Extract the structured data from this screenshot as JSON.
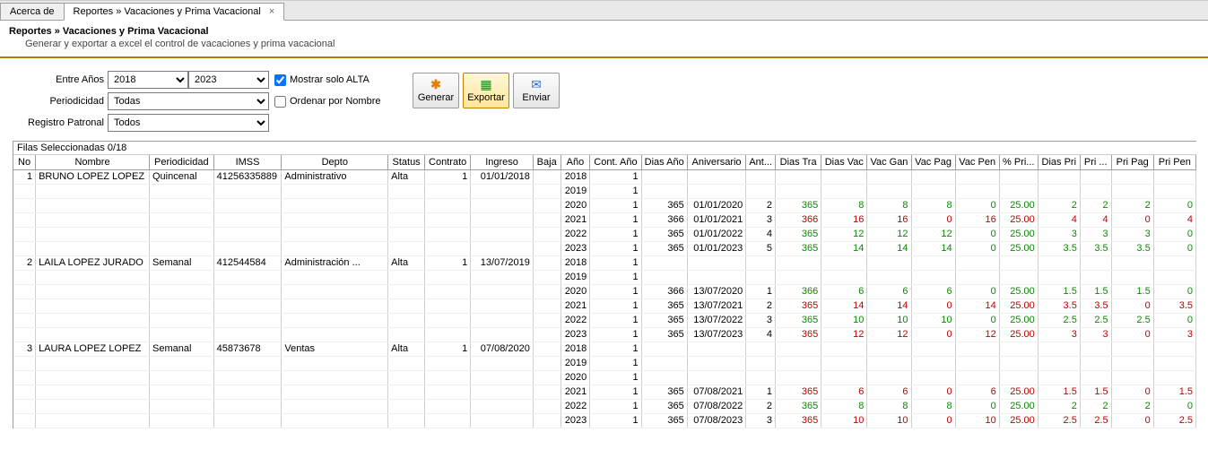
{
  "tabs": [
    {
      "label": "Acerca de",
      "active": false,
      "closable": false
    },
    {
      "label": "Reportes » Vacaciones y Prima Vacacional",
      "active": true,
      "closable": true
    }
  ],
  "header": {
    "title": "Reportes » Vacaciones y Prima Vacacional",
    "subtitle": "Generar y exportar a excel el control de vacaciones y prima vacacional"
  },
  "controls": {
    "entre_anos_label": "Entre Años",
    "year_from": "2018",
    "year_to": "2023",
    "mostrar_alta_label": "Mostrar solo ALTA",
    "mostrar_alta_checked": true,
    "periodicidad_label": "Periodicidad",
    "periodicidad_value": "Todas",
    "ordenar_label": "Ordenar por Nombre",
    "ordenar_checked": false,
    "registro_label": "Registro Patronal",
    "registro_value": "Todos",
    "btn_generar": "Generar",
    "btn_exportar": "Exportar",
    "btn_enviar": "Enviar"
  },
  "grid": {
    "selection": "Filas Seleccionadas  0/18",
    "columns": [
      "No",
      "Nombre",
      "Periodicidad",
      "IMSS",
      "Depto",
      "Status",
      "Contrato",
      "Ingreso",
      "Baja",
      "Año",
      "Cont. Año",
      "Dias Año",
      "Aniversario",
      "Ant...",
      "Dias Tra",
      "Dias Vac",
      "Vac Gan",
      "Vac Pag",
      "Vac Pen",
      "% Pri...",
      "Dias Pri",
      "Pri ...",
      "Pri Pag",
      "Pri Pen"
    ],
    "employees": [
      {
        "no": "1",
        "nombre": "BRUNO LOPEZ LOPEZ",
        "periodicidad": "Quincenal",
        "imss": "41256335889",
        "depto": "Administrativo",
        "status": "Alta",
        "contrato": "1",
        "ingreso": "01/01/2018",
        "baja": "",
        "years": [
          {
            "ano": "2018",
            "cont": "1",
            "diasano": "",
            "aniv": "",
            "ant": "",
            "diastra": "",
            "diasvac": "",
            "vacgan": "",
            "vacpag": "",
            "vacpen": "",
            "pct": "",
            "diaspri": "",
            "pri": "",
            "pripag": "",
            "pripen": ""
          },
          {
            "ano": "2019",
            "cont": "1",
            "diasano": "",
            "aniv": "",
            "ant": "",
            "diastra": "",
            "diasvac": "",
            "vacgan": "",
            "vacpag": "",
            "vacpen": "",
            "pct": "",
            "diaspri": "",
            "pri": "",
            "pripag": "",
            "pripen": ""
          },
          {
            "ano": "2020",
            "cont": "1",
            "diasano": "365",
            "aniv": "01/01/2020",
            "ant": "2",
            "diastra": {
              "v": "365",
              "c": "green"
            },
            "diasvac": {
              "v": "8",
              "c": "green"
            },
            "vacgan": {
              "v": "8",
              "c": "green"
            },
            "vacpag": {
              "v": "8",
              "c": "green"
            },
            "vacpen": {
              "v": "0",
              "c": "green"
            },
            "pct": {
              "v": "25.00",
              "c": "green"
            },
            "diaspri": {
              "v": "2",
              "c": "green"
            },
            "pri": {
              "v": "2",
              "c": "green"
            },
            "pripag": {
              "v": "2",
              "c": "green"
            },
            "pripen": {
              "v": "0",
              "c": "green"
            }
          },
          {
            "ano": "2021",
            "cont": "1",
            "diasano": "366",
            "aniv": "01/01/2021",
            "ant": "3",
            "diastra": {
              "v": "366",
              "c": "red"
            },
            "diasvac": {
              "v": "16",
              "c": "red"
            },
            "vacgan": {
              "v": "16",
              "c": "red"
            },
            "vacpag": {
              "v": "0",
              "c": "red"
            },
            "vacpen": {
              "v": "16",
              "c": "red"
            },
            "pct": {
              "v": "25.00",
              "c": "red"
            },
            "diaspri": {
              "v": "4",
              "c": "red"
            },
            "pri": {
              "v": "4",
              "c": "red"
            },
            "pripag": {
              "v": "0",
              "c": "red"
            },
            "pripen": {
              "v": "4",
              "c": "red"
            }
          },
          {
            "ano": "2022",
            "cont": "1",
            "diasano": "365",
            "aniv": "01/01/2022",
            "ant": "4",
            "diastra": {
              "v": "365",
              "c": "green"
            },
            "diasvac": {
              "v": "12",
              "c": "green"
            },
            "vacgan": {
              "v": "12",
              "c": "green"
            },
            "vacpag": {
              "v": "12",
              "c": "green"
            },
            "vacpen": {
              "v": "0",
              "c": "green"
            },
            "pct": {
              "v": "25.00",
              "c": "green"
            },
            "diaspri": {
              "v": "3",
              "c": "green"
            },
            "pri": {
              "v": "3",
              "c": "green"
            },
            "pripag": {
              "v": "3",
              "c": "green"
            },
            "pripen": {
              "v": "0",
              "c": "green"
            }
          },
          {
            "ano": "2023",
            "cont": "1",
            "diasano": "365",
            "aniv": "01/01/2023",
            "ant": "5",
            "diastra": {
              "v": "365",
              "c": "green"
            },
            "diasvac": {
              "v": "14",
              "c": "green"
            },
            "vacgan": {
              "v": "14",
              "c": "green"
            },
            "vacpag": {
              "v": "14",
              "c": "green"
            },
            "vacpen": {
              "v": "0",
              "c": "green"
            },
            "pct": {
              "v": "25.00",
              "c": "green"
            },
            "diaspri": {
              "v": "3.5",
              "c": "green"
            },
            "pri": {
              "v": "3.5",
              "c": "green"
            },
            "pripag": {
              "v": "3.5",
              "c": "green"
            },
            "pripen": {
              "v": "0",
              "c": "green"
            }
          }
        ]
      },
      {
        "no": "2",
        "nombre": "LAILA LOPEZ JURADO",
        "periodicidad": "Semanal",
        "imss": "412544584",
        "depto": "Administración ...",
        "status": "Alta",
        "contrato": "1",
        "ingreso": "13/07/2019",
        "baja": "",
        "years": [
          {
            "ano": "2018",
            "cont": "1",
            "diasano": "",
            "aniv": "",
            "ant": "",
            "diastra": "",
            "diasvac": "",
            "vacgan": "",
            "vacpag": "",
            "vacpen": "",
            "pct": "",
            "diaspri": "",
            "pri": "",
            "pripag": "",
            "pripen": ""
          },
          {
            "ano": "2019",
            "cont": "1",
            "diasano": "",
            "aniv": "",
            "ant": "",
            "diastra": "",
            "diasvac": "",
            "vacgan": "",
            "vacpag": "",
            "vacpen": "",
            "pct": "",
            "diaspri": "",
            "pri": "",
            "pripag": "",
            "pripen": ""
          },
          {
            "ano": "2020",
            "cont": "1",
            "diasano": "366",
            "aniv": "13/07/2020",
            "ant": "1",
            "diastra": {
              "v": "366",
              "c": "green"
            },
            "diasvac": {
              "v": "6",
              "c": "green"
            },
            "vacgan": {
              "v": "6",
              "c": "green"
            },
            "vacpag": {
              "v": "6",
              "c": "green"
            },
            "vacpen": {
              "v": "0",
              "c": "green"
            },
            "pct": {
              "v": "25.00",
              "c": "green"
            },
            "diaspri": {
              "v": "1.5",
              "c": "green"
            },
            "pri": {
              "v": "1.5",
              "c": "green"
            },
            "pripag": {
              "v": "1.5",
              "c": "green"
            },
            "pripen": {
              "v": "0",
              "c": "green"
            }
          },
          {
            "ano": "2021",
            "cont": "1",
            "diasano": "365",
            "aniv": "13/07/2021",
            "ant": "2",
            "diastra": {
              "v": "365",
              "c": "red"
            },
            "diasvac": {
              "v": "14",
              "c": "red"
            },
            "vacgan": {
              "v": "14",
              "c": "red"
            },
            "vacpag": {
              "v": "0",
              "c": "red"
            },
            "vacpen": {
              "v": "14",
              "c": "red"
            },
            "pct": {
              "v": "25.00",
              "c": "red"
            },
            "diaspri": {
              "v": "3.5",
              "c": "red"
            },
            "pri": {
              "v": "3.5",
              "c": "red"
            },
            "pripag": {
              "v": "0",
              "c": "red"
            },
            "pripen": {
              "v": "3.5",
              "c": "red"
            }
          },
          {
            "ano": "2022",
            "cont": "1",
            "diasano": "365",
            "aniv": "13/07/2022",
            "ant": "3",
            "diastra": {
              "v": "365",
              "c": "green"
            },
            "diasvac": {
              "v": "10",
              "c": "green"
            },
            "vacgan": {
              "v": "10",
              "c": "green"
            },
            "vacpag": {
              "v": "10",
              "c": "green"
            },
            "vacpen": {
              "v": "0",
              "c": "green"
            },
            "pct": {
              "v": "25.00",
              "c": "green"
            },
            "diaspri": {
              "v": "2.5",
              "c": "green"
            },
            "pri": {
              "v": "2.5",
              "c": "green"
            },
            "pripag": {
              "v": "2.5",
              "c": "green"
            },
            "pripen": {
              "v": "0",
              "c": "green"
            }
          },
          {
            "ano": "2023",
            "cont": "1",
            "diasano": "365",
            "aniv": "13/07/2023",
            "ant": "4",
            "diastra": {
              "v": "365",
              "c": "red"
            },
            "diasvac": {
              "v": "12",
              "c": "red"
            },
            "vacgan": {
              "v": "12",
              "c": "red"
            },
            "vacpag": {
              "v": "0",
              "c": "red"
            },
            "vacpen": {
              "v": "12",
              "c": "red"
            },
            "pct": {
              "v": "25.00",
              "c": "red"
            },
            "diaspri": {
              "v": "3",
              "c": "red"
            },
            "pri": {
              "v": "3",
              "c": "red"
            },
            "pripag": {
              "v": "0",
              "c": "red"
            },
            "pripen": {
              "v": "3",
              "c": "red"
            }
          }
        ]
      },
      {
        "no": "3",
        "nombre": "LAURA LOPEZ LOPEZ",
        "periodicidad": "Semanal",
        "imss": "45873678",
        "depto": "Ventas",
        "status": "Alta",
        "contrato": "1",
        "ingreso": "07/08/2020",
        "baja": "",
        "years": [
          {
            "ano": "2018",
            "cont": "1",
            "diasano": "",
            "aniv": "",
            "ant": "",
            "diastra": "",
            "diasvac": "",
            "vacgan": "",
            "vacpag": "",
            "vacpen": "",
            "pct": "",
            "diaspri": "",
            "pri": "",
            "pripag": "",
            "pripen": ""
          },
          {
            "ano": "2019",
            "cont": "1",
            "diasano": "",
            "aniv": "",
            "ant": "",
            "diastra": "",
            "diasvac": "",
            "vacgan": "",
            "vacpag": "",
            "vacpen": "",
            "pct": "",
            "diaspri": "",
            "pri": "",
            "pripag": "",
            "pripen": ""
          },
          {
            "ano": "2020",
            "cont": "1",
            "diasano": "",
            "aniv": "",
            "ant": "",
            "diastra": "",
            "diasvac": "",
            "vacgan": "",
            "vacpag": "",
            "vacpen": "",
            "pct": "",
            "diaspri": "",
            "pri": "",
            "pripag": "",
            "pripen": ""
          },
          {
            "ano": "2021",
            "cont": "1",
            "diasano": "365",
            "aniv": "07/08/2021",
            "ant": "1",
            "diastra": {
              "v": "365",
              "c": "red"
            },
            "diasvac": {
              "v": "6",
              "c": "red"
            },
            "vacgan": {
              "v": "6",
              "c": "red"
            },
            "vacpag": {
              "v": "0",
              "c": "red"
            },
            "vacpen": {
              "v": "6",
              "c": "red"
            },
            "pct": {
              "v": "25.00",
              "c": "red"
            },
            "diaspri": {
              "v": "1.5",
              "c": "red"
            },
            "pri": {
              "v": "1.5",
              "c": "red"
            },
            "pripag": {
              "v": "0",
              "c": "red"
            },
            "pripen": {
              "v": "1.5",
              "c": "red"
            }
          },
          {
            "ano": "2022",
            "cont": "1",
            "diasano": "365",
            "aniv": "07/08/2022",
            "ant": "2",
            "diastra": {
              "v": "365",
              "c": "green"
            },
            "diasvac": {
              "v": "8",
              "c": "green"
            },
            "vacgan": {
              "v": "8",
              "c": "green"
            },
            "vacpag": {
              "v": "8",
              "c": "green"
            },
            "vacpen": {
              "v": "0",
              "c": "green"
            },
            "pct": {
              "v": "25.00",
              "c": "green"
            },
            "diaspri": {
              "v": "2",
              "c": "green"
            },
            "pri": {
              "v": "2",
              "c": "green"
            },
            "pripag": {
              "v": "2",
              "c": "green"
            },
            "pripen": {
              "v": "0",
              "c": "green"
            }
          },
          {
            "ano": "2023",
            "cont": "1",
            "diasano": "365",
            "aniv": "07/08/2023",
            "ant": "3",
            "diastra": {
              "v": "365",
              "c": "red"
            },
            "diasvac": {
              "v": "10",
              "c": "red"
            },
            "vacgan": {
              "v": "10",
              "c": "red"
            },
            "vacpag": {
              "v": "0",
              "c": "red"
            },
            "vacpen": {
              "v": "10",
              "c": "red"
            },
            "pct": {
              "v": "25.00",
              "c": "red"
            },
            "diaspri": {
              "v": "2.5",
              "c": "red"
            },
            "pri": {
              "v": "2.5",
              "c": "red"
            },
            "pripag": {
              "v": "0",
              "c": "red"
            },
            "pripen": {
              "v": "2.5",
              "c": "red"
            }
          }
        ]
      }
    ]
  }
}
